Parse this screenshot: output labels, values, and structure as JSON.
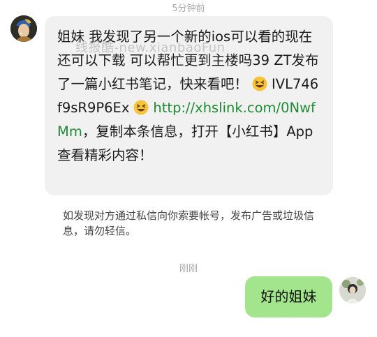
{
  "timestamps": {
    "first": "5分钟前",
    "second": "刚刚"
  },
  "watermark": "线报酷-new.xianbaoFun",
  "incoming": {
    "avatar_icon": "girl-with-pearl-earring-avatar",
    "text_before": "姐妹 我发现了另一个新的ios可以看的现在还可以下载 可以帮忙更到主楼吗39 ZT发布了一篇小红书笔记，快来看吧！",
    "emoji_icon": "grinning-squinting-face-emoji",
    "code": "IVL746f9sR9P6Ex",
    "link": "http://xhslink.com/0NwfMm",
    "text_after": "，复制本条信息，打开【小红书】App查看精彩内容！"
  },
  "notice": "如发现对方通过私信向你索要帐号，发布广告或垃圾信息，请勿轻信。",
  "outgoing": {
    "avatar_icon": "user-photo-avatar",
    "text": "好的姐妹"
  },
  "colors": {
    "link": "#1f8a34",
    "outgoing_bubble": "#a3e58c",
    "incoming_bubble": "#f1f1f1"
  }
}
